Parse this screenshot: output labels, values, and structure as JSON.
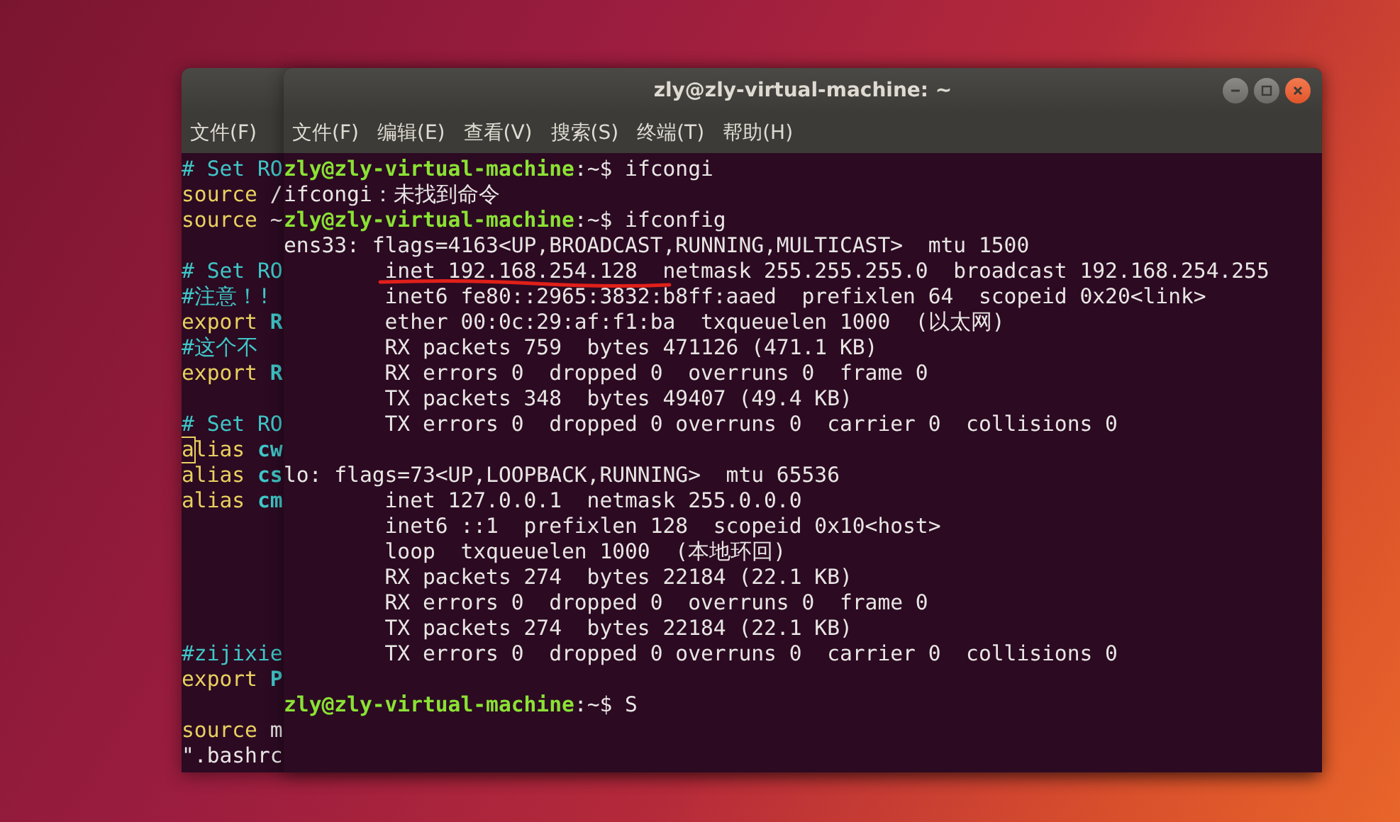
{
  "back_window": {
    "menu": [
      "文件(F)"
    ],
    "lines": [
      {
        "kind": "text",
        "segments": [
          {
            "kind": "comment",
            "text": "# Set RO"
          }
        ]
      },
      {
        "kind": "text",
        "segments": [
          {
            "kind": "keyword",
            "text": "source"
          },
          {
            "kind": "plain",
            "text": " /"
          }
        ]
      },
      {
        "kind": "text",
        "segments": [
          {
            "kind": "keyword",
            "text": "source"
          },
          {
            "kind": "plain",
            "text": " ~"
          }
        ]
      },
      {
        "kind": "blank"
      },
      {
        "kind": "text",
        "segments": [
          {
            "kind": "comment",
            "text": "# Set RO"
          }
        ]
      },
      {
        "kind": "text",
        "segments": [
          {
            "kind": "comment",
            "text": "#注意！!"
          }
        ]
      },
      {
        "kind": "text",
        "segments": [
          {
            "kind": "keyword",
            "text": "export"
          },
          {
            "kind": "name",
            "text": " R"
          }
        ]
      },
      {
        "kind": "text",
        "segments": [
          {
            "kind": "comment",
            "text": "#这个不"
          }
        ]
      },
      {
        "kind": "text",
        "segments": [
          {
            "kind": "keyword",
            "text": "export"
          },
          {
            "kind": "name",
            "text": " R"
          }
        ]
      },
      {
        "kind": "blank"
      },
      {
        "kind": "text",
        "segments": [
          {
            "kind": "comment",
            "text": "# Set RO"
          }
        ]
      },
      {
        "kind": "text",
        "segments": [
          {
            "kind": "cursor",
            "text": "a"
          },
          {
            "kind": "keyword",
            "text": "lias"
          },
          {
            "kind": "name",
            "text": " cw"
          }
        ]
      },
      {
        "kind": "text",
        "segments": [
          {
            "kind": "keyword",
            "text": "alias"
          },
          {
            "kind": "name",
            "text": " cs"
          }
        ]
      },
      {
        "kind": "text",
        "segments": [
          {
            "kind": "keyword",
            "text": "alias"
          },
          {
            "kind": "name",
            "text": " cm"
          }
        ]
      },
      {
        "kind": "blank"
      },
      {
        "kind": "blank"
      },
      {
        "kind": "blank"
      },
      {
        "kind": "blank"
      },
      {
        "kind": "blank"
      },
      {
        "kind": "text",
        "segments": [
          {
            "kind": "comment",
            "text": "#zijixie"
          }
        ]
      },
      {
        "kind": "text",
        "segments": [
          {
            "kind": "keyword",
            "text": "export"
          },
          {
            "kind": "name",
            "text": " P"
          }
        ]
      },
      {
        "kind": "blank"
      },
      {
        "kind": "text",
        "segments": [
          {
            "kind": "keyword",
            "text": "source"
          },
          {
            "kind": "plain",
            "text": " m"
          }
        ]
      },
      {
        "kind": "text",
        "segments": [
          {
            "kind": "plain",
            "text": "\".bashrc"
          }
        ]
      }
    ]
  },
  "front_window": {
    "title": "zly@zly-virtual-machine: ~",
    "menu": [
      "文件(F)",
      "编辑(E)",
      "查看(V)",
      "搜索(S)",
      "终端(T)",
      "帮助(H)"
    ],
    "lines": [
      {
        "kind": "text",
        "segments": [
          {
            "kind": "prompt",
            "text": "zly@zly-virtual-machine"
          },
          {
            "kind": "plain",
            "text": ":~$ ifcongi"
          }
        ]
      },
      {
        "kind": "text",
        "segments": [
          {
            "kind": "plain",
            "text": "ifcongi：未找到命令"
          }
        ]
      },
      {
        "kind": "text",
        "segments": [
          {
            "kind": "prompt",
            "text": "zly@zly-virtual-machine"
          },
          {
            "kind": "plain",
            "text": ":~$ ifconfig"
          }
        ]
      },
      {
        "kind": "text",
        "segments": [
          {
            "kind": "plain",
            "text": "ens33: flags=4163<UP,BROADCAST,RUNNING,MULTICAST>  mtu 1500"
          }
        ]
      },
      {
        "kind": "text",
        "underlined": true,
        "segments": [
          {
            "kind": "plain",
            "text": "        inet 192.168.254.128  netmask 255.255.255.0  broadcast 192.168.254.255"
          }
        ]
      },
      {
        "kind": "text",
        "segments": [
          {
            "kind": "plain",
            "text": "        inet6 fe80::2965:3832:b8ff:aaed  prefixlen 64  scopeid 0x20<link>"
          }
        ]
      },
      {
        "kind": "text",
        "segments": [
          {
            "kind": "plain",
            "text": "        ether 00:0c:29:af:f1:ba  txqueuelen 1000  (以太网)"
          }
        ]
      },
      {
        "kind": "text",
        "segments": [
          {
            "kind": "plain",
            "text": "        RX packets 759  bytes 471126 (471.1 KB)"
          }
        ]
      },
      {
        "kind": "text",
        "segments": [
          {
            "kind": "plain",
            "text": "        RX errors 0  dropped 0  overruns 0  frame 0"
          }
        ]
      },
      {
        "kind": "text",
        "segments": [
          {
            "kind": "plain",
            "text": "        TX packets 348  bytes 49407 (49.4 KB)"
          }
        ]
      },
      {
        "kind": "text",
        "segments": [
          {
            "kind": "plain",
            "text": "        TX errors 0  dropped 0 overruns 0  carrier 0  collisions 0"
          }
        ]
      },
      {
        "kind": "blank"
      },
      {
        "kind": "text",
        "segments": [
          {
            "kind": "plain",
            "text": "lo: flags=73<UP,LOOPBACK,RUNNING>  mtu 65536"
          }
        ]
      },
      {
        "kind": "text",
        "segments": [
          {
            "kind": "plain",
            "text": "        inet 127.0.0.1  netmask 255.0.0.0"
          }
        ]
      },
      {
        "kind": "text",
        "segments": [
          {
            "kind": "plain",
            "text": "        inet6 ::1  prefixlen 128  scopeid 0x10<host>"
          }
        ]
      },
      {
        "kind": "text",
        "segments": [
          {
            "kind": "plain",
            "text": "        loop  txqueuelen 1000  (本地环回)"
          }
        ]
      },
      {
        "kind": "text",
        "segments": [
          {
            "kind": "plain",
            "text": "        RX packets 274  bytes 22184 (22.1 KB)"
          }
        ]
      },
      {
        "kind": "text",
        "segments": [
          {
            "kind": "plain",
            "text": "        RX errors 0  dropped 0  overruns 0  frame 0"
          }
        ]
      },
      {
        "kind": "text",
        "segments": [
          {
            "kind": "plain",
            "text": "        TX packets 274  bytes 22184 (22.1 KB)"
          }
        ]
      },
      {
        "kind": "text",
        "segments": [
          {
            "kind": "plain",
            "text": "        TX errors 0  dropped 0 overruns 0  carrier 0  collisions 0"
          }
        ]
      },
      {
        "kind": "blank"
      },
      {
        "kind": "text",
        "segments": [
          {
            "kind": "prompt",
            "text": "zly@zly-virtual-machine"
          },
          {
            "kind": "plain",
            "text": ":~$ S"
          }
        ]
      }
    ]
  }
}
